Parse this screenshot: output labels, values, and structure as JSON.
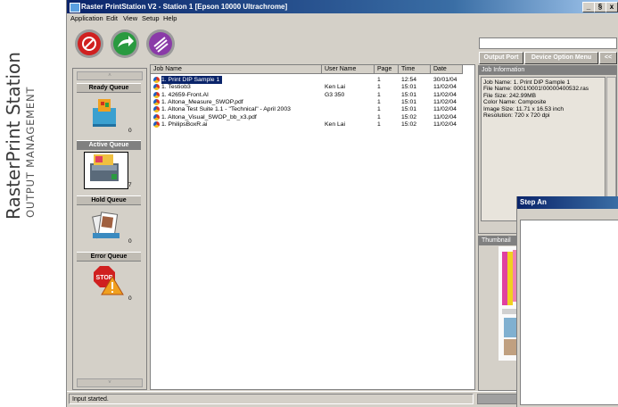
{
  "brand": {
    "name": "RasterPrint Station",
    "subtitle": "OUTPUT MANAGEMENT"
  },
  "window": {
    "title": "Raster PrintStation V2 - Station 1 [Epson 10000 Ultrachrome]",
    "minimize": "_",
    "maximize": "§",
    "close": "x"
  },
  "menu": [
    "Application",
    "Edit",
    "View",
    "Setup",
    "Help"
  ],
  "toolbar": {
    "stop_icon": "stop-icon",
    "forward_icon": "forward-arrow-icon",
    "purge_icon": "purge-icon",
    "output_port_label": "Output Port",
    "device_option_label": "Device Option Menu",
    "collapse_label": "<<"
  },
  "queues": [
    {
      "label": "Ready Queue",
      "count": "0",
      "icon": "ready-queue-icon"
    },
    {
      "label": "Active Queue",
      "count": "7",
      "icon": "active-queue-printer-icon"
    },
    {
      "label": "Hold Queue",
      "count": "0",
      "icon": "hold-queue-icon"
    },
    {
      "label": "Error Queue",
      "count": "0",
      "icon": "error-queue-stop-icon"
    }
  ],
  "scroll": {
    "up": "˄",
    "down": "˅"
  },
  "job_table": {
    "columns": [
      "Job Name",
      "User Name",
      "Page",
      "Time",
      "Date"
    ],
    "rows": [
      {
        "name": "1. Print DIP Sample 1",
        "user": "",
        "page": "1",
        "time": "12:54",
        "date": "30/01/04",
        "selected": true
      },
      {
        "name": "1. Testiob3",
        "user": "Ken Lai",
        "page": "1",
        "time": "15:01",
        "date": "11/02/04"
      },
      {
        "name": "1. 42659-Front.AI",
        "user": "G3 350",
        "page": "1",
        "time": "15:01",
        "date": "11/02/04"
      },
      {
        "name": "1. Altona_Measure_SWOP.pdf",
        "user": "",
        "page": "1",
        "time": "15:01",
        "date": "11/02/04"
      },
      {
        "name": "1. Altona Test Suite 1.1 - \"Technical\" - April 2003",
        "user": "",
        "page": "1",
        "time": "15:01",
        "date": "11/02/04"
      },
      {
        "name": "1. Altona_Visual_SWOP_bb_x3.pdf",
        "user": "",
        "page": "1",
        "time": "15:02",
        "date": "11/02/04"
      },
      {
        "name": "1. PhilipsBoxR.ai",
        "user": "Ken Lai",
        "page": "1",
        "time": "15:02",
        "date": "11/02/04"
      }
    ]
  },
  "job_info": {
    "title": "Job Information",
    "lines": [
      "Job Name: 1. Print DIP Sample 1",
      "File Name: 0001!0001!00000400532.ras",
      "File Size: 242.99MB",
      "Color Name: Composite",
      "Image Size: 11.71 x 16.53 inch",
      "Resolution: 720 x 720 dpi"
    ]
  },
  "thumbnail": {
    "title": "Thumbnail"
  },
  "step_dialog": {
    "title": "Step An"
  },
  "status": {
    "text": "Input started.",
    "right": ""
  },
  "colors": {
    "title_bar": "#0a246a",
    "window_bg": "#d4d0c8",
    "selection": "#0a246a"
  }
}
